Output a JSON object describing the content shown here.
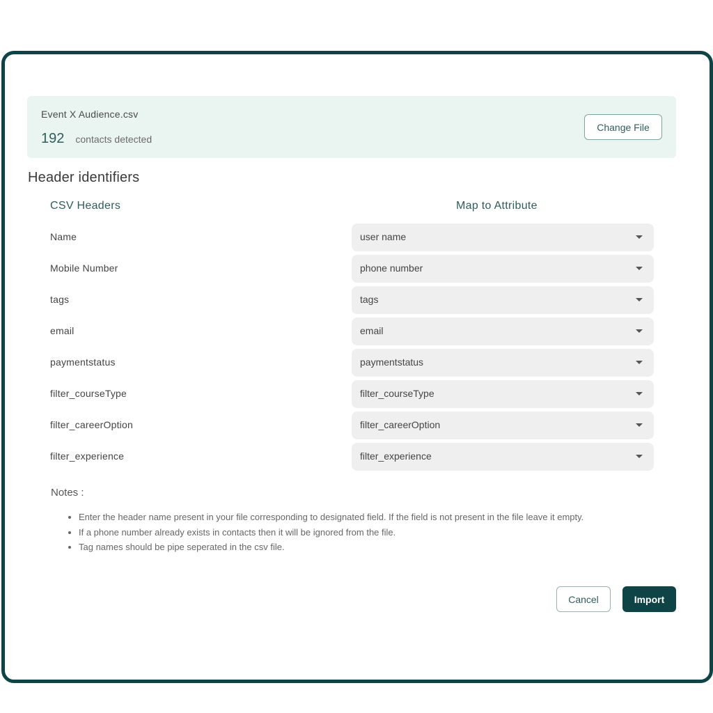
{
  "file": {
    "name": "Event X Audience.csv",
    "contacts_count": "192",
    "contacts_label": "contacts detected",
    "change_file_label": "Change File"
  },
  "section_title": "Header identifiers",
  "columns": {
    "csv_headers": "CSV Headers",
    "map_to_attribute": "Map to Attribute"
  },
  "mappings": [
    {
      "csv_header": "Name",
      "attribute": "user name"
    },
    {
      "csv_header": "Mobile Number",
      "attribute": "phone number"
    },
    {
      "csv_header": "tags",
      "attribute": "tags"
    },
    {
      "csv_header": "email",
      "attribute": "email"
    },
    {
      "csv_header": "paymentstatus",
      "attribute": "paymentstatus"
    },
    {
      "csv_header": "filter_courseType",
      "attribute": "filter_courseType"
    },
    {
      "csv_header": "filter_careerOption",
      "attribute": "filter_careerOption"
    },
    {
      "csv_header": "filter_experience",
      "attribute": "filter_experience"
    }
  ],
  "notes": {
    "title": "Notes :",
    "items": [
      "Enter the header name present in your file corresponding to designated field. If the field is not present in the file leave it empty.",
      "If a phone number already exists in contacts then it will be ignored from the file.",
      "Tag names should be pipe seperated in the csv file."
    ]
  },
  "actions": {
    "cancel_label": "Cancel",
    "import_label": "Import"
  },
  "colors": {
    "primary": "#0f4446",
    "banner_bg": "#eaf4f1",
    "select_bg": "#efefef",
    "heading_teal": "#2f5d5a"
  },
  "icons": {
    "dropdown": "caret-down-icon"
  }
}
